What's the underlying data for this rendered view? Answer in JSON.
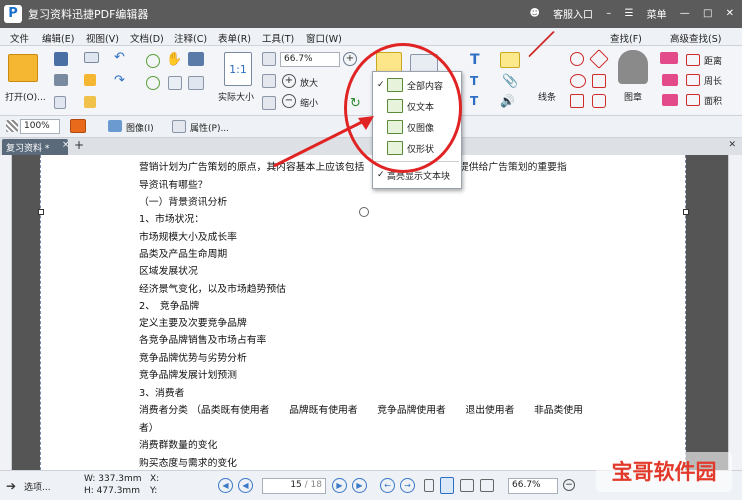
{
  "app": {
    "logo_letter": "P",
    "title": "复习资料迅捷PDF编辑器",
    "service": "客服入口",
    "menu": "菜单"
  },
  "menubar": [
    "文件",
    "编辑(E)",
    "视图(V)",
    "文档(D)",
    "注释(C)",
    "表单(R)",
    "工具(T)",
    "窗口(W)"
  ],
  "menubar_right": {
    "find": "查找(F)",
    "advanced_find": "高级查找(S)"
  },
  "ribbon": {
    "open": "打开(O)...",
    "actual_size": "实际大小",
    "actual_size_glyph": "1:1",
    "zoom_value": "66.7%",
    "zoom_in": "放大",
    "zoom_out": "缩小",
    "line": "线条",
    "stamp": "图章",
    "distance": "距离",
    "perimeter": "周长",
    "area": "面积"
  },
  "toolbar2": {
    "zoom": "100%",
    "image": "图像(I)",
    "properties": "属性(P)..."
  },
  "dropdown": {
    "items": [
      "全部内容",
      "仅文本",
      "仅图像",
      "仅形状"
    ],
    "highlight": "高亮显示文本块"
  },
  "tab": {
    "name": "复习资料 *",
    "close": "×",
    "add": "+"
  },
  "document": {
    "lines": [
      "营销计划为广告策划的原点，其内容基本上应该包括",
      "导资讯有哪些？",
      "（一）背景资讯分析",
      "1、市场状况：",
      "市场规模大小及成长率",
      "品类及产品生命周期",
      "区域发展状况",
      "经济景气变化，以及市场趋势预估",
      "2、　竞争品牌",
      "定义主要及次要竞争品牌",
      "各竞争品牌销售及市场占有率",
      "竞争品牌优势与劣势分析",
      "竞争品牌发展计划预测",
      "3、消费者",
      "消费者分类 （品类既有使用者　　品牌既有使用者　　竞争品牌使用者　　退出使用者　　非品类使用",
      "者）",
      "消费群数量的变化",
      "购买态度与需求的变化",
      "需求的变化及购买行为"
    ],
    "line1_tail": "提供给广告策划的重要指"
  },
  "status": {
    "select": "选项...",
    "width": "W: 337.3mm",
    "height": "H: 477.3mm",
    "x": "X:",
    "y": "Y:",
    "page": "15",
    "page_total": "/ 18",
    "zoom": "66.7%"
  },
  "watermark": "宝哥软件园",
  "colors": {
    "accent": "#3a78c8",
    "annotation": "#e02424",
    "title_bg": "#5b5b5b"
  }
}
